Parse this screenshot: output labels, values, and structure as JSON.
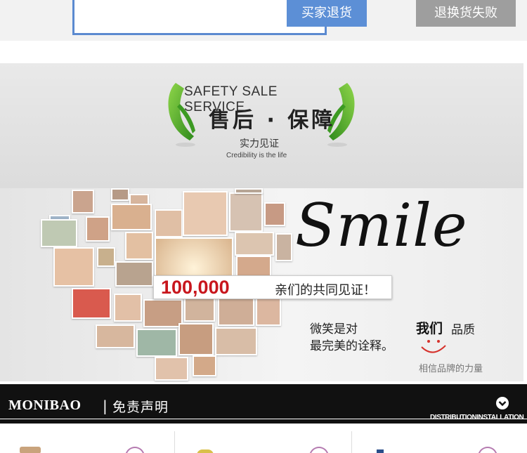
{
  "top": {
    "return_button": "买家退货",
    "fail_button": "退换货失败"
  },
  "service": {
    "title_en": "SAFETY SALE SERVICE",
    "title_cn": "售后 · 保障",
    "subtitle_cn": "实力见证",
    "subtitle_en": "Credibility is the life"
  },
  "smile": {
    "word": "Smile",
    "count": "100,000",
    "count_text": "亲们的共同见证！",
    "line1": "微笑是对",
    "line2": "最完美的诠释。",
    "quality_bold": "我们",
    "quality_rest": "品质",
    "brand_power": "相信品牌的力量"
  },
  "footer": {
    "brand": "MONIBAO",
    "separator": "|",
    "title": "免责声明",
    "distribution": "DISTRIBUTIONINSTALLATION"
  },
  "colors": {
    "return_button": "#5c8fd6",
    "fail_button": "#9e9e9e",
    "count_red": "#c8161d",
    "bar": "#111111"
  }
}
